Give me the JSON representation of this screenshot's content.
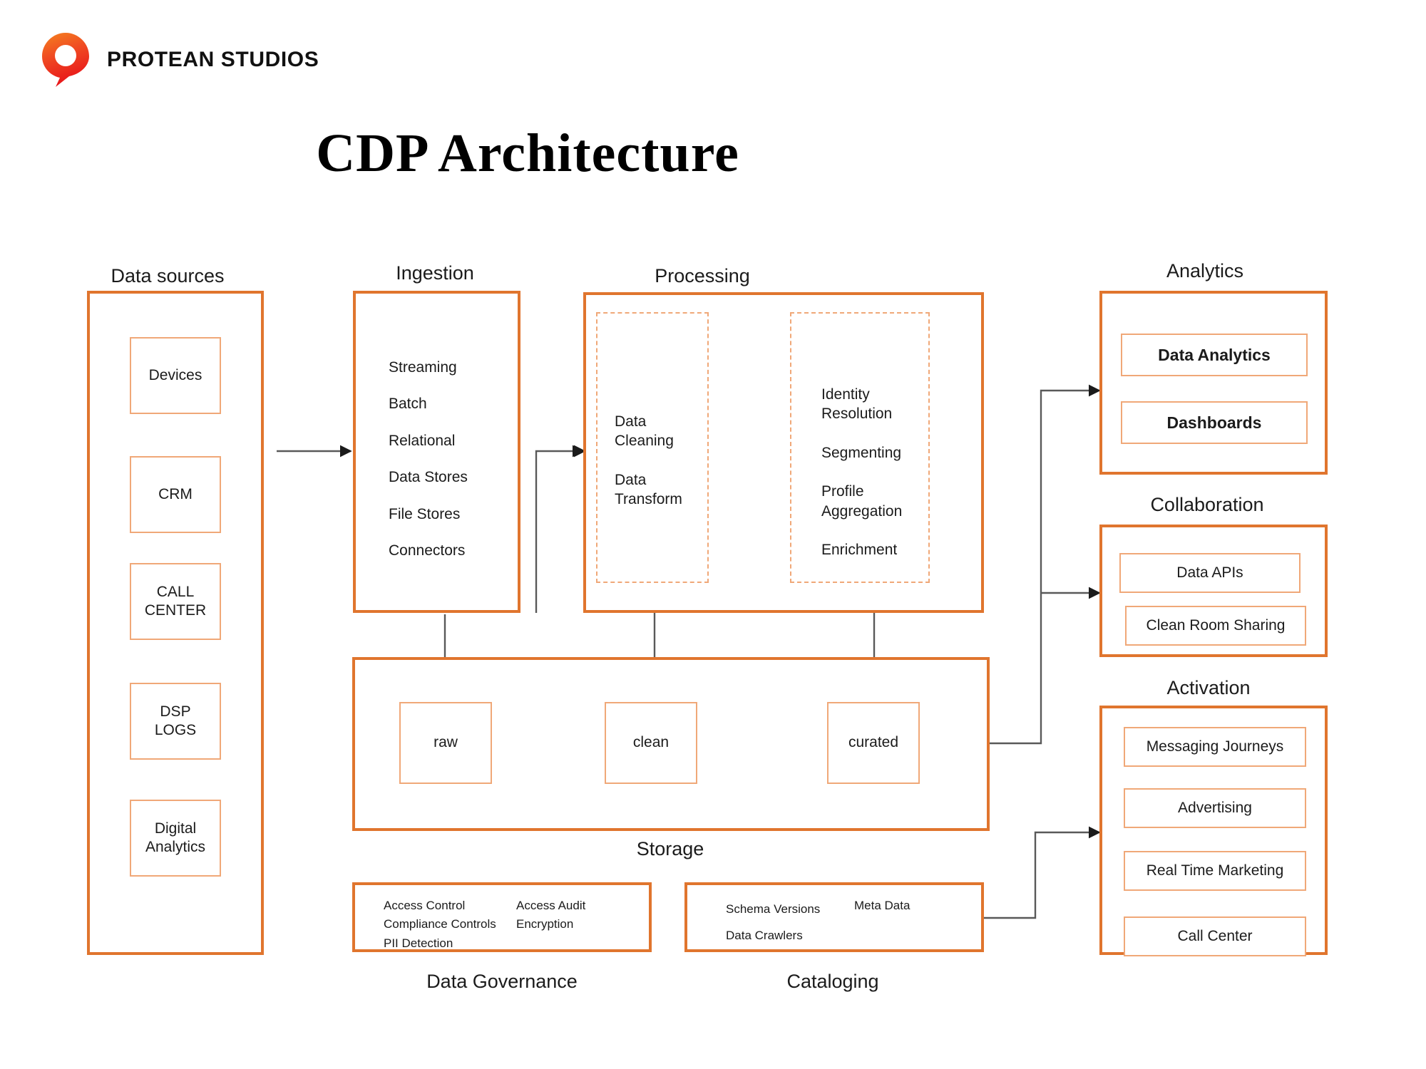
{
  "brand": {
    "name": "PROTEAN STUDIOS",
    "logo_icon": "protean-pin-logo",
    "logo_color": "#F03018"
  },
  "title": "CDP Architecture",
  "theme": {
    "outer_border": "#E0752E",
    "inner_border": "#F0A878",
    "dashed_border": "#F0A878",
    "wire": "#595959",
    "text": "#1b1b1b"
  },
  "stages": {
    "data_sources": {
      "label": "Data sources",
      "items": [
        "Devices",
        "CRM",
        "CALL\nCENTER",
        "DSP\nLOGS",
        "Digital\nAnalytics"
      ]
    },
    "ingestion": {
      "label": "Ingestion",
      "items": [
        "Streaming",
        "Batch",
        "Relational\nData Stores",
        "File Stores",
        "Connectors"
      ]
    },
    "processing": {
      "label": "Processing",
      "group_left": {
        "items": [
          "Data\nCleaning",
          "Data\nTransform"
        ]
      },
      "group_right": {
        "items": [
          "Identity\nResolution",
          "Segmenting",
          "Profile\nAggregation",
          "Enrichment"
        ]
      }
    },
    "storage": {
      "label": "Storage",
      "zones": [
        "raw",
        "clean",
        "curated"
      ]
    },
    "data_governance": {
      "label": "Data Governance",
      "column_left": [
        "Access Control",
        "Compliance Controls",
        "PII Detection"
      ],
      "column_right": [
        "Access Audit",
        "Encryption"
      ]
    },
    "cataloging": {
      "label": "Cataloging",
      "column_left": [
        "Schema Versions",
        "Data Crawlers"
      ],
      "column_right": [
        "Meta Data"
      ]
    },
    "analytics": {
      "label": "Analytics",
      "items": [
        "Data Analytics",
        "Dashboards"
      ]
    },
    "collaboration": {
      "label": "Collaboration",
      "items": [
        "Data APIs",
        "Clean Room Sharing"
      ]
    },
    "activation": {
      "label": "Activation",
      "items": [
        "Messaging Journeys",
        "Advertising",
        "Real Time Marketing",
        "Call Center"
      ]
    }
  }
}
